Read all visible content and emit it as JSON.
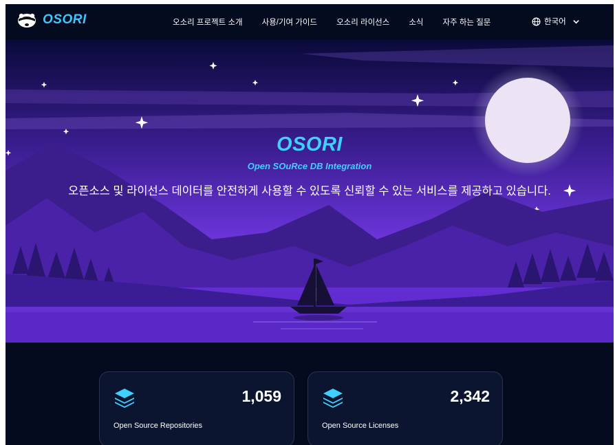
{
  "header": {
    "logo_text": "OSORI",
    "nav": [
      {
        "label": "오소리 프로젝트 소개"
      },
      {
        "label": "사용/기여 가이드"
      },
      {
        "label": "오소리 라이선스"
      },
      {
        "label": "소식"
      },
      {
        "label": "자주 하는 질문"
      }
    ],
    "language": {
      "selected": "한국어",
      "icon": "globe-icon",
      "chevron": "chevron-down-icon"
    }
  },
  "hero": {
    "title": "OSORI",
    "subtitle": "Open SOuRce DB Integration",
    "description": "오픈소스 및 라이선스 데이터를 안전하게 사용할 수 있도록 신뢰할 수 있는 서비스를 제공하고 있습니다."
  },
  "stats": [
    {
      "value": "1,059",
      "label": "Open Source Repositories",
      "icon": "layers-icon"
    },
    {
      "value": "2,342",
      "label": "Open Source Licenses",
      "icon": "layers-icon"
    }
  ],
  "colors": {
    "accent": "#3fd0ff",
    "background": "#050b1f",
    "hero_purple": "#5a27c9",
    "card_bg": "#0b1530"
  }
}
